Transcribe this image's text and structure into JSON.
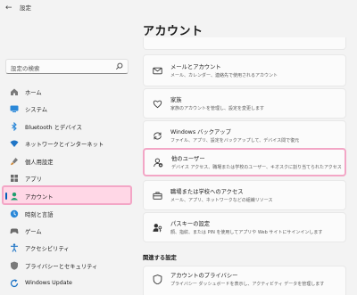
{
  "window": {
    "title": "設定"
  },
  "sidebar": {
    "search_placeholder": "設定の検索",
    "items": [
      {
        "label": "ホーム",
        "icon": "home-icon"
      },
      {
        "label": "システム",
        "icon": "system-icon"
      },
      {
        "label": "Bluetooth とデバイス",
        "icon": "bluetooth-icon"
      },
      {
        "label": "ネットワークとインターネット",
        "icon": "network-icon"
      },
      {
        "label": "個人用設定",
        "icon": "personalization-icon"
      },
      {
        "label": "アプリ",
        "icon": "apps-icon"
      },
      {
        "label": "アカウント",
        "icon": "accounts-icon",
        "selected": true
      },
      {
        "label": "時刻と言語",
        "icon": "time-language-icon"
      },
      {
        "label": "ゲーム",
        "icon": "gaming-icon"
      },
      {
        "label": "アクセシビリティ",
        "icon": "accessibility-icon"
      },
      {
        "label": "プライバシーとセキュリティ",
        "icon": "privacy-icon"
      },
      {
        "label": "Windows Update",
        "icon": "windows-update-icon"
      }
    ]
  },
  "main": {
    "title": "アカウント",
    "cards": [
      {
        "title": "メールとアカウント",
        "desc": "メール、カレンダー、連絡先で使用されるアカウント"
      },
      {
        "title": "家族",
        "desc": "家族のアカウントを管理し、設定を変更します"
      },
      {
        "title": "Windows バックアップ",
        "desc": "ファイル、アプリ、設定をバックアップして、デバイス間で復元"
      },
      {
        "title": "他のユーザー",
        "desc": "デバイス アクセス、職場または学校のユーザー、キオスクに割り当てられたアクセス"
      },
      {
        "title": "職場または学校へのアクセス",
        "desc": "メール、アプリ、ネットワークなどの組織リソース"
      },
      {
        "title": "パスキーの設定",
        "desc": "顔、指紋、または PIN を使用してアプリや Web サイトにサインインします"
      },
      {
        "title": "アカウントのプライバシー",
        "desc": "プライバシー ダッシュボードを表示し、アクティビティ データを管理します"
      }
    ],
    "related_label": "関連する設定"
  },
  "colors": {
    "accent": "#005fb8",
    "highlight_border": "#f3a6c6",
    "highlight_fill": "#ffd7e6"
  }
}
